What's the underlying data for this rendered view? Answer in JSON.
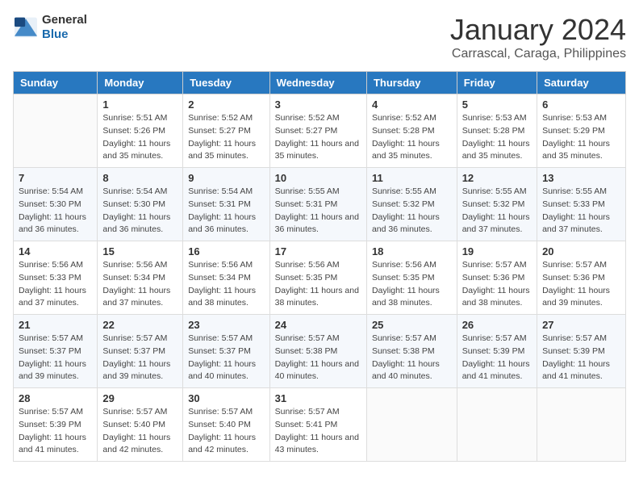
{
  "logo": {
    "general": "General",
    "blue": "Blue"
  },
  "title": "January 2024",
  "location": "Carrascal, Caraga, Philippines",
  "days_header": [
    "Sunday",
    "Monday",
    "Tuesday",
    "Wednesday",
    "Thursday",
    "Friday",
    "Saturday"
  ],
  "weeks": [
    [
      null,
      {
        "num": "1",
        "sunrise": "5:51 AM",
        "sunset": "5:26 PM",
        "daylight": "11 hours and 35 minutes."
      },
      {
        "num": "2",
        "sunrise": "5:52 AM",
        "sunset": "5:27 PM",
        "daylight": "11 hours and 35 minutes."
      },
      {
        "num": "3",
        "sunrise": "5:52 AM",
        "sunset": "5:27 PM",
        "daylight": "11 hours and 35 minutes."
      },
      {
        "num": "4",
        "sunrise": "5:52 AM",
        "sunset": "5:28 PM",
        "daylight": "11 hours and 35 minutes."
      },
      {
        "num": "5",
        "sunrise": "5:53 AM",
        "sunset": "5:28 PM",
        "daylight": "11 hours and 35 minutes."
      },
      {
        "num": "6",
        "sunrise": "5:53 AM",
        "sunset": "5:29 PM",
        "daylight": "11 hours and 35 minutes."
      }
    ],
    [
      {
        "num": "7",
        "sunrise": "5:54 AM",
        "sunset": "5:30 PM",
        "daylight": "11 hours and 36 minutes."
      },
      {
        "num": "8",
        "sunrise": "5:54 AM",
        "sunset": "5:30 PM",
        "daylight": "11 hours and 36 minutes."
      },
      {
        "num": "9",
        "sunrise": "5:54 AM",
        "sunset": "5:31 PM",
        "daylight": "11 hours and 36 minutes."
      },
      {
        "num": "10",
        "sunrise": "5:55 AM",
        "sunset": "5:31 PM",
        "daylight": "11 hours and 36 minutes."
      },
      {
        "num": "11",
        "sunrise": "5:55 AM",
        "sunset": "5:32 PM",
        "daylight": "11 hours and 36 minutes."
      },
      {
        "num": "12",
        "sunrise": "5:55 AM",
        "sunset": "5:32 PM",
        "daylight": "11 hours and 37 minutes."
      },
      {
        "num": "13",
        "sunrise": "5:55 AM",
        "sunset": "5:33 PM",
        "daylight": "11 hours and 37 minutes."
      }
    ],
    [
      {
        "num": "14",
        "sunrise": "5:56 AM",
        "sunset": "5:33 PM",
        "daylight": "11 hours and 37 minutes."
      },
      {
        "num": "15",
        "sunrise": "5:56 AM",
        "sunset": "5:34 PM",
        "daylight": "11 hours and 37 minutes."
      },
      {
        "num": "16",
        "sunrise": "5:56 AM",
        "sunset": "5:34 PM",
        "daylight": "11 hours and 38 minutes."
      },
      {
        "num": "17",
        "sunrise": "5:56 AM",
        "sunset": "5:35 PM",
        "daylight": "11 hours and 38 minutes."
      },
      {
        "num": "18",
        "sunrise": "5:56 AM",
        "sunset": "5:35 PM",
        "daylight": "11 hours and 38 minutes."
      },
      {
        "num": "19",
        "sunrise": "5:57 AM",
        "sunset": "5:36 PM",
        "daylight": "11 hours and 38 minutes."
      },
      {
        "num": "20",
        "sunrise": "5:57 AM",
        "sunset": "5:36 PM",
        "daylight": "11 hours and 39 minutes."
      }
    ],
    [
      {
        "num": "21",
        "sunrise": "5:57 AM",
        "sunset": "5:37 PM",
        "daylight": "11 hours and 39 minutes."
      },
      {
        "num": "22",
        "sunrise": "5:57 AM",
        "sunset": "5:37 PM",
        "daylight": "11 hours and 39 minutes."
      },
      {
        "num": "23",
        "sunrise": "5:57 AM",
        "sunset": "5:37 PM",
        "daylight": "11 hours and 40 minutes."
      },
      {
        "num": "24",
        "sunrise": "5:57 AM",
        "sunset": "5:38 PM",
        "daylight": "11 hours and 40 minutes."
      },
      {
        "num": "25",
        "sunrise": "5:57 AM",
        "sunset": "5:38 PM",
        "daylight": "11 hours and 40 minutes."
      },
      {
        "num": "26",
        "sunrise": "5:57 AM",
        "sunset": "5:39 PM",
        "daylight": "11 hours and 41 minutes."
      },
      {
        "num": "27",
        "sunrise": "5:57 AM",
        "sunset": "5:39 PM",
        "daylight": "11 hours and 41 minutes."
      }
    ],
    [
      {
        "num": "28",
        "sunrise": "5:57 AM",
        "sunset": "5:39 PM",
        "daylight": "11 hours and 41 minutes."
      },
      {
        "num": "29",
        "sunrise": "5:57 AM",
        "sunset": "5:40 PM",
        "daylight": "11 hours and 42 minutes."
      },
      {
        "num": "30",
        "sunrise": "5:57 AM",
        "sunset": "5:40 PM",
        "daylight": "11 hours and 42 minutes."
      },
      {
        "num": "31",
        "sunrise": "5:57 AM",
        "sunset": "5:41 PM",
        "daylight": "11 hours and 43 minutes."
      },
      null,
      null,
      null
    ]
  ],
  "labels": {
    "sunrise": "Sunrise:",
    "sunset": "Sunset:",
    "daylight": "Daylight:"
  }
}
